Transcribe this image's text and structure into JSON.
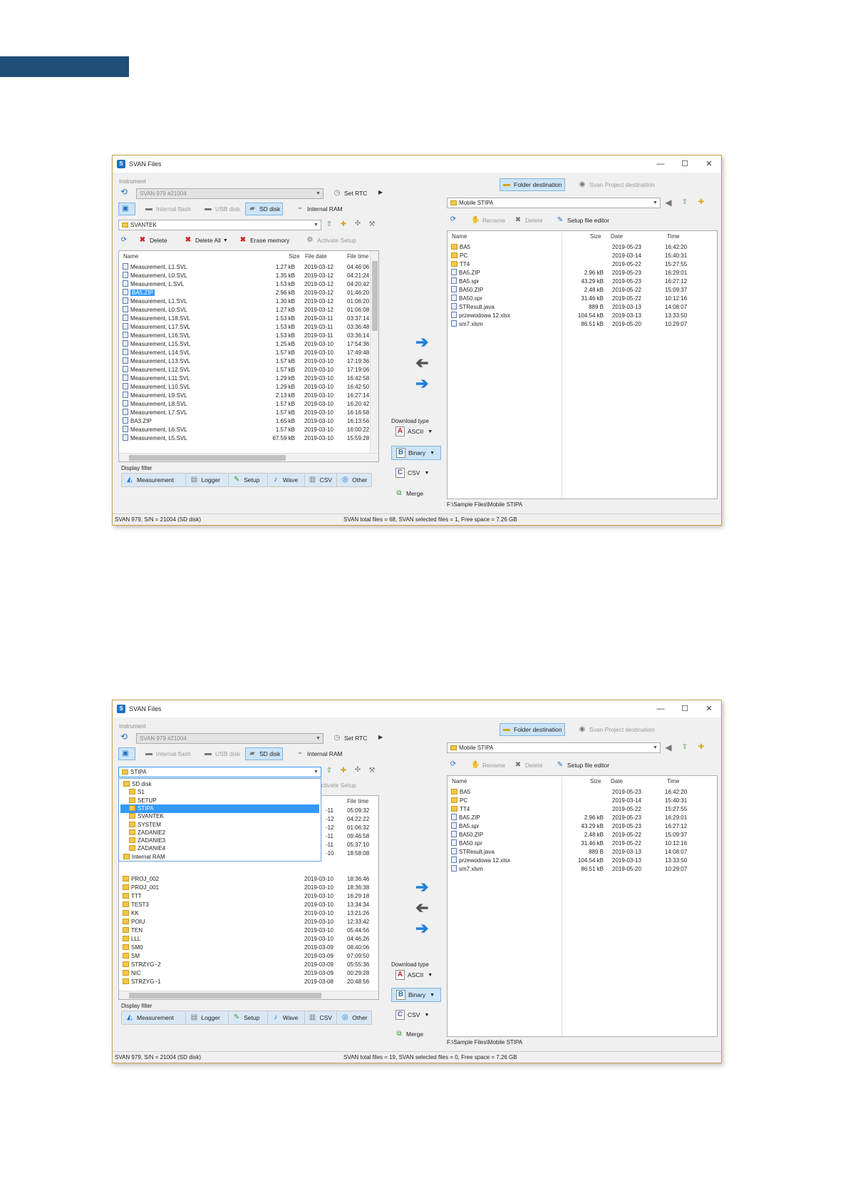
{
  "app": {
    "title": "SVAN Files",
    "win_controls": [
      "—",
      "☐",
      "✕"
    ]
  },
  "common": {
    "instrument_label": "Instrument",
    "instrument_value": "SVAN 979 #21004",
    "set_rtc": "Set RTC",
    "memory_tabs": [
      "Internal flash",
      "USB disk",
      "SD disk",
      "Internal RAM"
    ],
    "toolbar": {
      "delete": "Delete",
      "delete_all": "Delete All",
      "erase_memory": "Erase memory",
      "activate_setup": "Activate Setup"
    },
    "cols_left": [
      "Name",
      "Size",
      "File date",
      "File time"
    ],
    "display_filter": "Display filter",
    "filters": [
      "Measurement",
      "Logger",
      "Setup",
      "Wave",
      "CSV",
      "Other"
    ],
    "download_type": "Download type",
    "dl": [
      "ASCII",
      "Binary",
      "CSV"
    ],
    "merge": "Merge",
    "dest_tabs": [
      "Folder destination",
      "Svan Project destination"
    ],
    "dest_combo": "Mobile STIPA",
    "right_toolbar": {
      "rename": "Rename",
      "delete": "Delete",
      "setup_editor": "Setup file editor"
    },
    "cols_right": [
      "Name",
      "Size",
      "Date",
      "Time"
    ],
    "right_files": [
      {
        "n": "BA5",
        "s": "",
        "d": "2019-05-23",
        "t": "16:42:20",
        "k": "fo"
      },
      {
        "n": "PC",
        "s": "",
        "d": "2019-03-14",
        "t": "15:40:31",
        "k": "fo"
      },
      {
        "n": "TT4",
        "s": "",
        "d": "2019-05-22",
        "t": "15:27:55",
        "k": "fo"
      },
      {
        "n": "BA5.ZIP",
        "s": "2.96 kB",
        "d": "2019-05-23",
        "t": "16:29:01",
        "k": "fi"
      },
      {
        "n": "BA5.spr",
        "s": "43.29 kB",
        "d": "2019-05-23",
        "t": "16:27:12",
        "k": "fi"
      },
      {
        "n": "BA50.ZIP",
        "s": "2.48 kB",
        "d": "2019-05-22",
        "t": "15:09:37",
        "k": "fi"
      },
      {
        "n": "BA50.spr",
        "s": "31.46 kB",
        "d": "2019-05-22",
        "t": "10:12:16",
        "k": "fi"
      },
      {
        "n": "STResult.java",
        "s": "889 B",
        "d": "2019-03-13",
        "t": "14:08:07",
        "k": "fi"
      },
      {
        "n": "przewodowa 12.xlsx",
        "s": "104.54 kB",
        "d": "2019-03-13",
        "t": "13:33:50",
        "k": "fi"
      },
      {
        "n": "sm7.xlsm",
        "s": "86.51 kB",
        "d": "2019-05-20",
        "t": "10:29:07",
        "k": "fi"
      }
    ],
    "path": "F:\\Sample Files\\Mobile STIPA"
  },
  "win1": {
    "folder_combo": "SVANTEK",
    "left_files": [
      {
        "n": "Measurement, L1.SVL",
        "s": "1.27 kB",
        "d": "2019-03-12",
        "t": "04:46:06"
      },
      {
        "n": "Measurement, L0.SVL",
        "s": "1.35 kB",
        "d": "2019-03-12",
        "t": "04:21:24"
      },
      {
        "n": "Measurement, L.SVL",
        "s": "1.53 kB",
        "d": "2019-03-12",
        "t": "04:20:42"
      },
      {
        "n": "BA5.ZIP",
        "s": "2.96 kB",
        "d": "2019-03-12",
        "t": "01:46:20",
        "sel": true
      },
      {
        "n": "Measurement, L1.SVL",
        "s": "1.30 kB",
        "d": "2019-03-12",
        "t": "01:06:20"
      },
      {
        "n": "Measurement, L0.SVL",
        "s": "1.27 kB",
        "d": "2019-03-12",
        "t": "01:06:08"
      },
      {
        "n": "Measurement, L18.SVL",
        "s": "1.53 kB",
        "d": "2019-03-11",
        "t": "03:37:14"
      },
      {
        "n": "Measurement, L17.SVL",
        "s": "1.53 kB",
        "d": "2019-03-11",
        "t": "03:36:48"
      },
      {
        "n": "Measurement, L16.SVL",
        "s": "1.53 kB",
        "d": "2019-03-11",
        "t": "03:36:14"
      },
      {
        "n": "Measurement, L15.SVL",
        "s": "1.25 kB",
        "d": "2019-03-10",
        "t": "17:54:36"
      },
      {
        "n": "Measurement, L14.SVL",
        "s": "1.57 kB",
        "d": "2019-03-10",
        "t": "17:49:48"
      },
      {
        "n": "Measurement, L13.SVL",
        "s": "1.57 kB",
        "d": "2019-03-10",
        "t": "17:19:36"
      },
      {
        "n": "Measurement, L12.SVL",
        "s": "1.57 kB",
        "d": "2019-03-10",
        "t": "17:19:06"
      },
      {
        "n": "Measurement, L11.SVL",
        "s": "1.29 kB",
        "d": "2019-03-10",
        "t": "16:42:58"
      },
      {
        "n": "Measurement, L10.SVL",
        "s": "1.29 kB",
        "d": "2019-03-10",
        "t": "16:42:50"
      },
      {
        "n": "Measurement, L9.SVL",
        "s": "2.13 kB",
        "d": "2019-03-10",
        "t": "16:27:14"
      },
      {
        "n": "Measurement, L8.SVL",
        "s": "1.57 kB",
        "d": "2019-03-10",
        "t": "16:20:42"
      },
      {
        "n": "Measurement, L7.SVL",
        "s": "1.57 kB",
        "d": "2019-03-10",
        "t": "16:16:58"
      },
      {
        "n": "BA3.ZIP",
        "s": "1.65 kB",
        "d": "2019-03-10",
        "t": "16:13:56"
      },
      {
        "n": "Measurement, L6.SVL",
        "s": "1.57 kB",
        "d": "2019-03-10",
        "t": "16:00:22"
      },
      {
        "n": "Measurement, L5.SVL",
        "s": "67.59 kB",
        "d": "2019-03-10",
        "t": "15:59:28"
      }
    ],
    "status_left": "SVAN 979, S/N = 21004 (SD disk)",
    "status_right": "SVAN total files = 68, SVAN selected files = 1, Free space = 7.26 GB"
  },
  "win2": {
    "folder_combo": "STIPA",
    "dropdown": [
      {
        "n": "SD disk",
        "lvl": 0
      },
      {
        "n": "S1",
        "lvl": 1
      },
      {
        "n": "SETUP",
        "lvl": 1
      },
      {
        "n": "STIPA",
        "lvl": 1,
        "sel": true
      },
      {
        "n": "SVANTEK",
        "lvl": 1
      },
      {
        "n": "SYSTEM",
        "lvl": 1
      },
      {
        "n": "ZADANIE2",
        "lvl": 1
      },
      {
        "n": "ZADANIE3",
        "lvl": 1
      },
      {
        "n": "ZADANIE4",
        "lvl": 1
      },
      {
        "n": "Internal RAM",
        "lvl": 0
      }
    ],
    "hidden_rows": [
      {
        "d": "-11",
        "t": "05:09:32"
      },
      {
        "d": "-12",
        "t": "04:22:22"
      },
      {
        "d": "-12",
        "t": "01:06:32"
      },
      {
        "d": "-11",
        "t": "09:46:58"
      },
      {
        "d": "-11",
        "t": "05:37:10"
      },
      {
        "d": "-10",
        "t": "18:58:08"
      }
    ],
    "left_files": [
      {
        "n": "PROJ_002",
        "d": "2019-03-10",
        "t": "18:36:46"
      },
      {
        "n": "PROJ_001",
        "d": "2019-03-10",
        "t": "18:36:38"
      },
      {
        "n": "TTT",
        "d": "2019-03-10",
        "t": "16:29:18"
      },
      {
        "n": "TEST3",
        "d": "2019-03-10",
        "t": "13:34:34"
      },
      {
        "n": "KK",
        "d": "2019-03-10",
        "t": "13:21:26"
      },
      {
        "n": "POIU",
        "d": "2019-03-10",
        "t": "12:33:42"
      },
      {
        "n": "TEN",
        "d": "2019-03-10",
        "t": "05:44:56"
      },
      {
        "n": "LLL",
        "d": "2019-03-10",
        "t": "04:46:26"
      },
      {
        "n": "SM0",
        "d": "2019-03-09",
        "t": "08:40:06"
      },
      {
        "n": "SM",
        "d": "2019-03-09",
        "t": "07:09:50"
      },
      {
        "n": "STRZYG~2",
        "d": "2019-03-09",
        "t": "05:55:36"
      },
      {
        "n": "NIC",
        "d": "2019-03-09",
        "t": "00:29:28"
      },
      {
        "n": "STRZYG~1",
        "d": "2019-03-08",
        "t": "20:48:56"
      }
    ],
    "status_left": "SVAN 979, S/N = 21004 (SD disk)",
    "status_right": "SVAN total files = 19, SVAN selected files = 0, Free space = 7.26 GB"
  }
}
